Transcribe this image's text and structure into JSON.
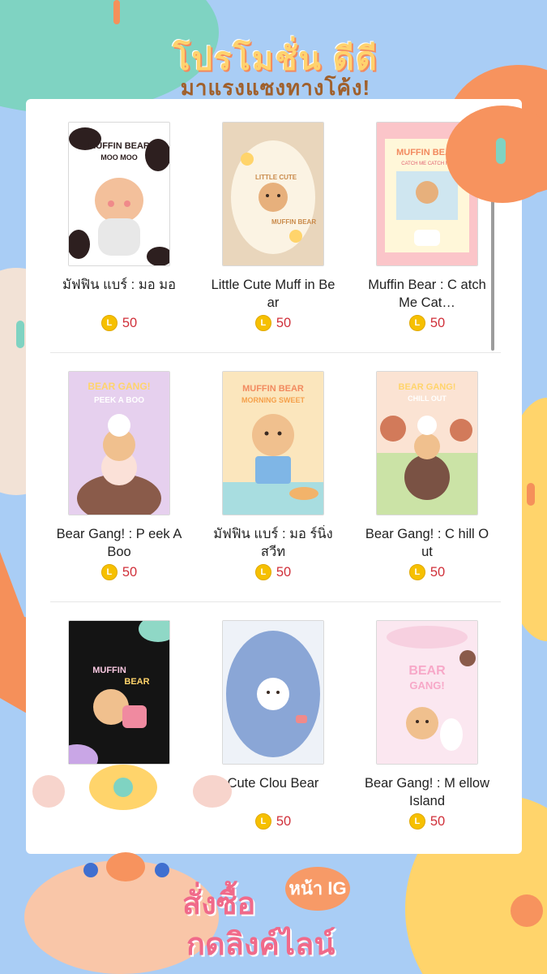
{
  "header": {
    "title": "โปรโมชั่น ดีดี",
    "subtitle": "มาแรงแซงทางโค้ง!"
  },
  "items": [
    {
      "name": "มัฟฟิน แบร์ : มอ มอ",
      "price": "50",
      "thumb_text": [
        "MUFFIN BEAR",
        "MOO MOO"
      ]
    },
    {
      "name": "Little Cute Muff in Bear",
      "price": "50",
      "thumb_text": [
        "LITTLE CUTE",
        "MUFFIN BEAR"
      ]
    },
    {
      "name": "Muffin Bear : C atch Me Cat…",
      "price": "50",
      "thumb_text": [
        "MUFFIN BEAR",
        "CATCH ME CATCH ME"
      ]
    },
    {
      "name": "Bear Gang! : P eek A Boo",
      "price": "50",
      "thumb_text": [
        "BEAR GANG!",
        "PEEK A BOO"
      ]
    },
    {
      "name": "มัฟฟิน แบร์ : มอ ร์นิ่ง สวีท",
      "price": "50",
      "thumb_text": [
        "MUFFIN BEAR",
        "MORNING SWEET"
      ]
    },
    {
      "name": "Bear Gang! : C hill Out",
      "price": "50",
      "thumb_text": [
        "BEAR GANG!",
        "CHILL OUT"
      ]
    },
    {
      "name": "",
      "price": "",
      "thumb_text": [
        "MUFFIN",
        "BEAR"
      ]
    },
    {
      "name": "Cute Clou Bear",
      "price": "50",
      "thumb_text": [
        "",
        ""
      ]
    },
    {
      "name": "Bear Gang! : M ellow Island",
      "price": "50",
      "thumb_text": [
        "BEAR",
        "GANG!"
      ]
    }
  ],
  "coin_symbol": "L",
  "cta": {
    "line1": "สั่งซื้อ",
    "badge": "หน้า IG",
    "line2": "กดลิงค์ไลน์"
  },
  "colors": {
    "background": "#a9cdf5",
    "price": "#d0303a",
    "coin": "#f6c000"
  }
}
